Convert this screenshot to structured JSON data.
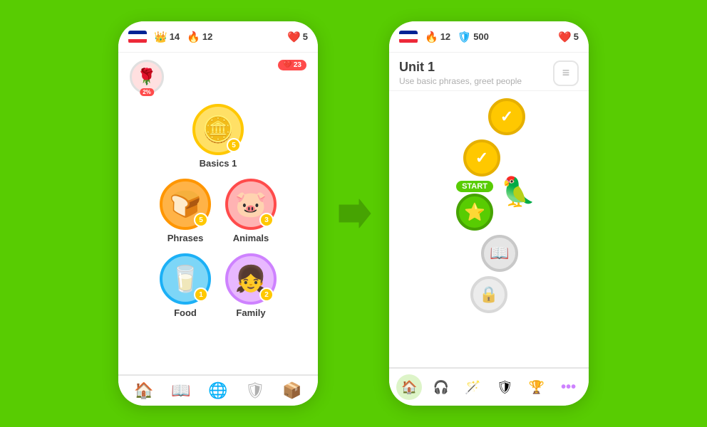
{
  "background": "#58cc02",
  "left_phone": {
    "top_bar": {
      "flag": "france",
      "stats": [
        {
          "icon": "👑",
          "type": "crown",
          "value": "14"
        },
        {
          "icon": "🔥",
          "type": "fire",
          "value": "12"
        },
        {
          "icon": "❤️",
          "type": "heart",
          "value": "5"
        }
      ]
    },
    "profile": {
      "avatar_emoji": "🌹",
      "pct": "2%",
      "broken_heart_count": "23"
    },
    "lessons": [
      {
        "id": "basics1",
        "emoji": "🪙",
        "label": "Basics 1",
        "badge": "5",
        "color": "gold",
        "single": true
      },
      {
        "id": "phrases",
        "emoji": "🍞",
        "label": "Phrases",
        "badge": "5",
        "color": "orange"
      },
      {
        "id": "animals",
        "emoji": "🐷",
        "label": "Animals",
        "badge": "3",
        "color": "pink"
      },
      {
        "id": "food",
        "emoji": "🥛",
        "label": "Food",
        "badge": "1",
        "color": "blue"
      },
      {
        "id": "family",
        "emoji": "👧",
        "label": "Family",
        "badge": "2",
        "color": "purple"
      }
    ],
    "bottom_nav": [
      {
        "icon": "🏠",
        "label": "home",
        "active": true
      },
      {
        "icon": "📖",
        "label": "learn",
        "active": false
      },
      {
        "icon": "🌐",
        "label": "explore",
        "active": false
      },
      {
        "icon": "🛡",
        "label": "league",
        "active": false
      },
      {
        "icon": "📦",
        "label": "shop",
        "active": false
      }
    ]
  },
  "arrow": "➡",
  "right_phone": {
    "top_bar": {
      "flag": "france",
      "stats": [
        {
          "icon": "🔥",
          "type": "fire",
          "value": "12"
        },
        {
          "icon": "🛡",
          "type": "shield",
          "value": "500"
        },
        {
          "icon": "❤️",
          "type": "heart",
          "value": "5"
        }
      ]
    },
    "unit": {
      "title": "Unit 1",
      "subtitle": "Use basic phrases, greet people"
    },
    "notes_btn": "≡",
    "path_nodes": [
      {
        "id": "node1",
        "type": "gold-check",
        "icon": "✓",
        "offset": "right"
      },
      {
        "id": "node2",
        "type": "gold-check",
        "icon": "✓",
        "offset": "center"
      },
      {
        "id": "node3",
        "type": "start",
        "icon": "⭐",
        "offset": "left",
        "start": true
      },
      {
        "id": "node4",
        "type": "gray",
        "icon": "📖",
        "offset": "right"
      },
      {
        "id": "node5",
        "type": "gray-lock",
        "icon": "🔒",
        "offset": "center"
      }
    ],
    "start_label": "START",
    "duo_emoji": "🦜",
    "bottom_nav": [
      {
        "icon": "🏠",
        "label": "home",
        "active": true,
        "color": "#58cc02"
      },
      {
        "icon": "🎧",
        "label": "listen",
        "active": false
      },
      {
        "icon": "🪄",
        "label": "practice",
        "active": false
      },
      {
        "icon": "🛡",
        "label": "league",
        "active": false
      },
      {
        "icon": "🏆",
        "label": "leaderboard",
        "active": false
      },
      {
        "icon": "⋯",
        "label": "more",
        "active": false
      }
    ]
  }
}
